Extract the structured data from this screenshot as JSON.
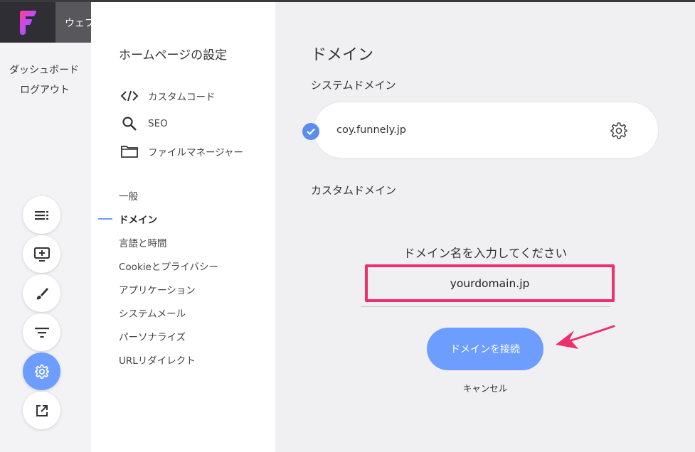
{
  "app": {
    "tab_title": "ウェブ",
    "accent_color": "#6d9eff",
    "highlight_color": "#ef2f6c"
  },
  "left_nav": {
    "links": [
      "ダッシュボード",
      "ログアウト"
    ]
  },
  "fab_icons": [
    "list-icon",
    "add-screen-icon",
    "brush-icon",
    "filter-icon",
    "settings-icon",
    "open-external-icon"
  ],
  "settings_panel": {
    "title": "ホームページの設定",
    "tools": [
      {
        "icon": "code-icon",
        "label": "カスタムコード"
      },
      {
        "icon": "search-icon",
        "label": "SEO"
      },
      {
        "icon": "folder-icon",
        "label": "ファイルマネージャー"
      }
    ],
    "menu": [
      "一般",
      "ドメイン",
      "言語と時間",
      "Cookieとプライバシー",
      "アプリケーション",
      "システムメール",
      "パーソナライズ",
      "URLリダイレクト"
    ],
    "active_menu": "ドメイン"
  },
  "main": {
    "title": "ドメイン",
    "system_domain_label": "システムドメイン",
    "system_domain": "coy.funnely.jp",
    "custom_domain_label": "カスタムドメイン",
    "prompt": "ドメイン名を入力してください",
    "input_value": "yourdomain.jp",
    "connect_button": "ドメインを接続",
    "cancel": "キャンセル"
  }
}
